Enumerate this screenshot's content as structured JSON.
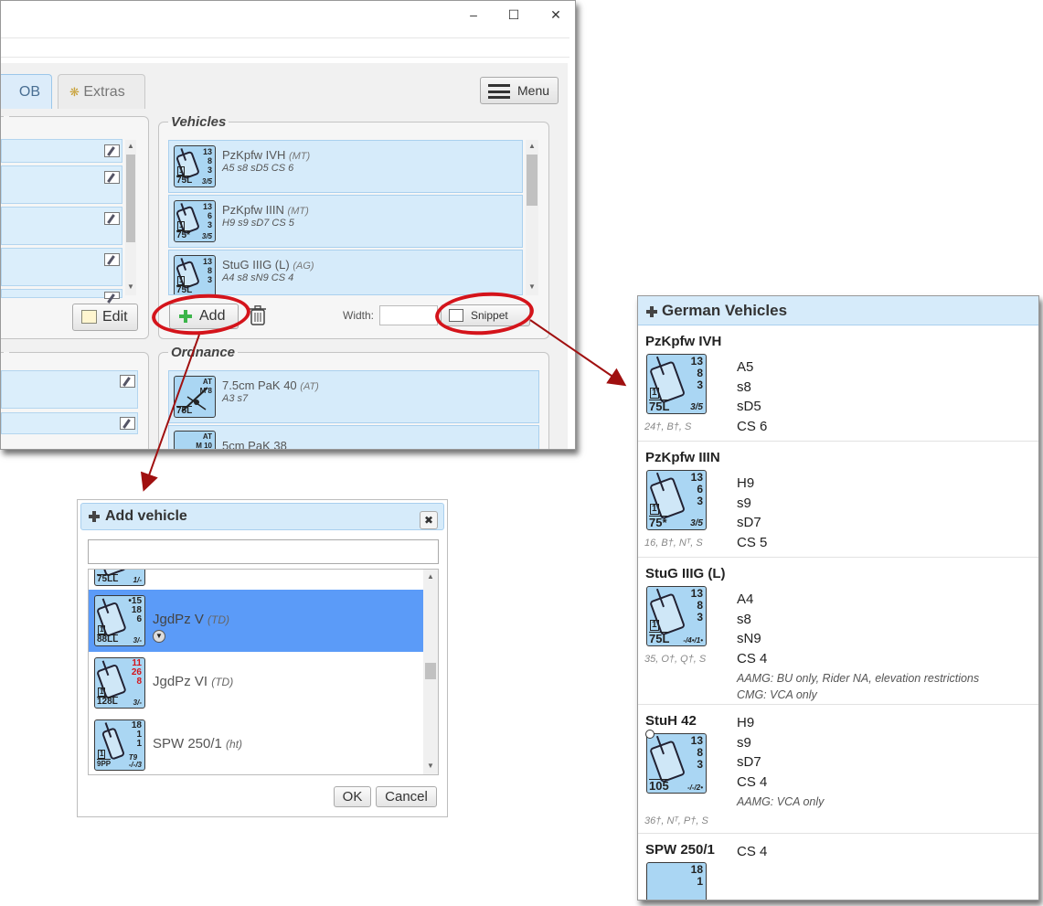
{
  "main_window": {
    "tabs": [
      {
        "label": "OB",
        "active": true
      },
      {
        "label": "Extras",
        "active": false
      }
    ],
    "menu_label": "Menu",
    "vehicles_legend": "Vehicles",
    "ordnance_legend": "Ordnance",
    "vehicles": [
      {
        "name": "PzKpfw IVH",
        "class": "(MT)",
        "stats": "A5  s8  sD5  CS 6",
        "counter": {
          "top": "13\n8\n3",
          "gun": "75L",
          "br": "3/5",
          "left": "1"
        }
      },
      {
        "name": "PzKpfw IIIN",
        "class": "(MT)",
        "stats": "H9  s9  sD7  CS 5",
        "counter": {
          "top": "13\n6\n3",
          "gun": "75*",
          "br": "3/5",
          "left": "1"
        }
      },
      {
        "name": "StuG IIIG (L)",
        "class": "(AG)",
        "stats": "A4  s8  sN9  CS 4",
        "counter": {
          "top": "13\n8\n3",
          "gun": "75L",
          "br": "",
          "left": "1"
        }
      }
    ],
    "ordnance": [
      {
        "name": "7.5cm PaK 40",
        "class": "(AT)",
        "stats": "A3  s7",
        "counter": {
          "top": "AT\nM 8",
          "gun": "75L",
          "br": "",
          "left": ""
        }
      },
      {
        "name": "5cm PaK 38",
        "class": "",
        "stats": "",
        "counter": {
          "top": "AT\nM 10",
          "gun": "",
          "br": "",
          "left": ""
        }
      }
    ],
    "edit_label": "Edit",
    "add_label": "Add",
    "width_label": "Width:",
    "width_value": "",
    "snippet_label": "Snippet"
  },
  "add_dialog": {
    "title": "Add vehicle",
    "search_value": "",
    "items": [
      {
        "name": "",
        "class": "",
        "counter": {
          "top": "",
          "gun": "75LL",
          "br": "1/-",
          "left": ""
        },
        "selected": false
      },
      {
        "name": "JgdPz V",
        "class": "(TD)",
        "counter": {
          "top": "•15\n18\n6",
          "gun": "88LL",
          "br": "3/-",
          "left": "1"
        },
        "selected": true
      },
      {
        "name": "JgdPz VI",
        "class": "(TD)",
        "counter": {
          "top": "11\n26\n8",
          "gun": "128L",
          "br": "3/-",
          "left": "1"
        },
        "selected": false
      },
      {
        "name": "SPW 250/1",
        "class": "(ht)",
        "counter": {
          "top": "18\n1\n1",
          "gun": "9PP",
          "br": "T9\n-/-/3",
          "left": "1"
        },
        "selected": false
      }
    ],
    "ok_label": "OK",
    "cancel_label": "Cancel"
  },
  "snippet_panel": {
    "title": "German Vehicles",
    "entries": [
      {
        "name": "PzKpfw IVH",
        "stats": [
          "A5",
          "s8",
          "sD5",
          "CS 6"
        ],
        "notes": "24†, B†, S",
        "extra": [],
        "counter": {
          "top": "13\n8\n3",
          "gun": "75L",
          "br": "3/5",
          "left": "1"
        }
      },
      {
        "name": "PzKpfw IIIN",
        "stats": [
          "H9",
          "s9",
          "sD7",
          "CS 5"
        ],
        "notes": "16, B†, Nᵀ, S",
        "extra": [],
        "counter": {
          "top": "13\n6\n3",
          "gun": "75*",
          "br": "3/5",
          "left": "1"
        }
      },
      {
        "name": "StuG IIIG (L)",
        "stats": [
          "A4",
          "s8",
          "sN9",
          "CS 4"
        ],
        "notes": "35, O†, Q†, S",
        "extra": [
          "AAMG: BU only, Rider NA, elevation restrictions",
          "CMG: VCA only"
        ],
        "counter": {
          "top": "13\n8\n3",
          "gun": "75L",
          "br": "-/4•/1•",
          "left": "1"
        }
      },
      {
        "name": "StuH 42",
        "stats": [
          "H9",
          "s9",
          "sD7",
          "CS 4"
        ],
        "notes": "36†, Nᵀ, P†, S",
        "extra": [
          "AAMG: VCA only"
        ],
        "counter": {
          "top": "13\n8\n3",
          "gun": "105",
          "br": "-/-/2•",
          "left": ""
        }
      },
      {
        "name": "SPW 250/1",
        "stats": [
          "CS 4"
        ],
        "notes": "",
        "extra": [],
        "counter": {
          "top": "18\n1",
          "gun": "",
          "br": "",
          "left": ""
        }
      }
    ]
  },
  "colors": {
    "highlight": "#d4141b",
    "row_bg": "#d6ebfa",
    "selected": "#5b9bf8"
  }
}
